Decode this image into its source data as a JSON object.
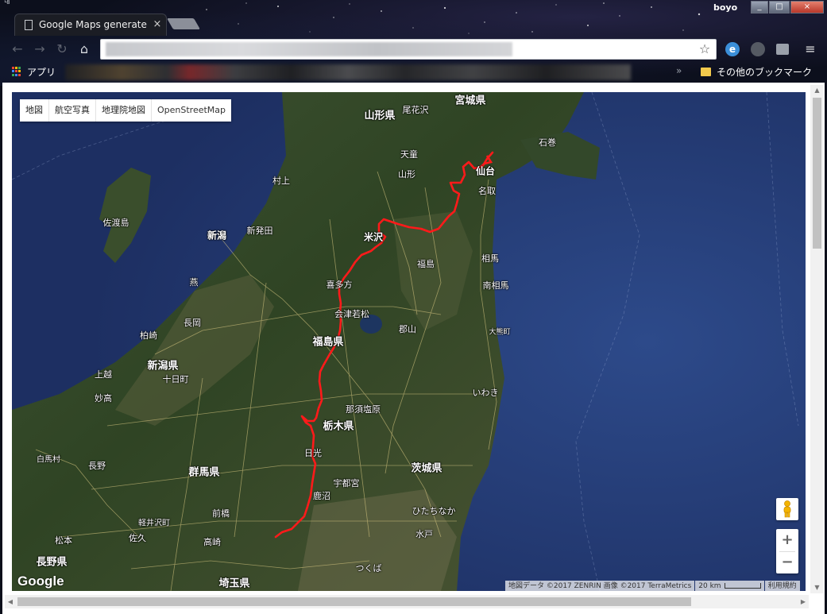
{
  "browser": {
    "tab_title": "Google Maps generate",
    "tab_close": "×",
    "user_name": "boyo",
    "window_min": "_",
    "window_max": "□",
    "window_close": "×",
    "nav_back": "←",
    "nav_forward": "→",
    "nav_reload": "↻",
    "nav_home": "⌂",
    "star": "☆",
    "extension_e": "e",
    "menu": "≡",
    "address": ""
  },
  "bookmarks": {
    "apps_label": "アプリ",
    "more": "»",
    "other_label": "その他のブックマーク"
  },
  "map_controls": {
    "map_types": [
      {
        "label": "地図"
      },
      {
        "label": "航空写真"
      },
      {
        "label": "地理院地図"
      },
      {
        "label": "OpenStreetMap"
      }
    ],
    "selected_type": "OpenStreetMap",
    "zoom_in": "+",
    "zoom_out": "−",
    "google_logo": "Google"
  },
  "attribution": {
    "data": "地図データ ©2017 ZENRIN 画像 ©2017 TerraMetrics",
    "scale": "20 km",
    "terms": "利用規約"
  },
  "map_labels": {
    "prefectures": [
      "山形県",
      "宮城県",
      "福島県",
      "新潟県",
      "栃木県",
      "群馬県",
      "茨城県",
      "長野県",
      "埼玉県"
    ],
    "cities": [
      "仙台",
      "米沢",
      "新潟",
      "福島",
      "会津若松",
      "宇都宮",
      "喜多方",
      "山形"
    ],
    "places": [
      "尾花沢",
      "天童",
      "石巻",
      "名取",
      "村上",
      "新発田",
      "佐渡島",
      "燕",
      "長岡",
      "柏崎",
      "上越",
      "妙高",
      "十日町",
      "郡山",
      "相馬",
      "南相馬",
      "大熊町",
      "いわき",
      "那須塩原",
      "日光",
      "鹿沼",
      "前橋",
      "高崎",
      "軽井沢町",
      "佐久",
      "松本",
      "白馬村",
      "長野",
      "ひたちなか",
      "水戸",
      "つくば"
    ]
  },
  "colors": {
    "route": "#ff1a1a",
    "sea": "#23396e",
    "land": "#3c4a2a"
  },
  "icons": {
    "pegman": "pegman-icon",
    "apps": "apps-grid-icon",
    "bookmark_folder": "folder-icon"
  }
}
